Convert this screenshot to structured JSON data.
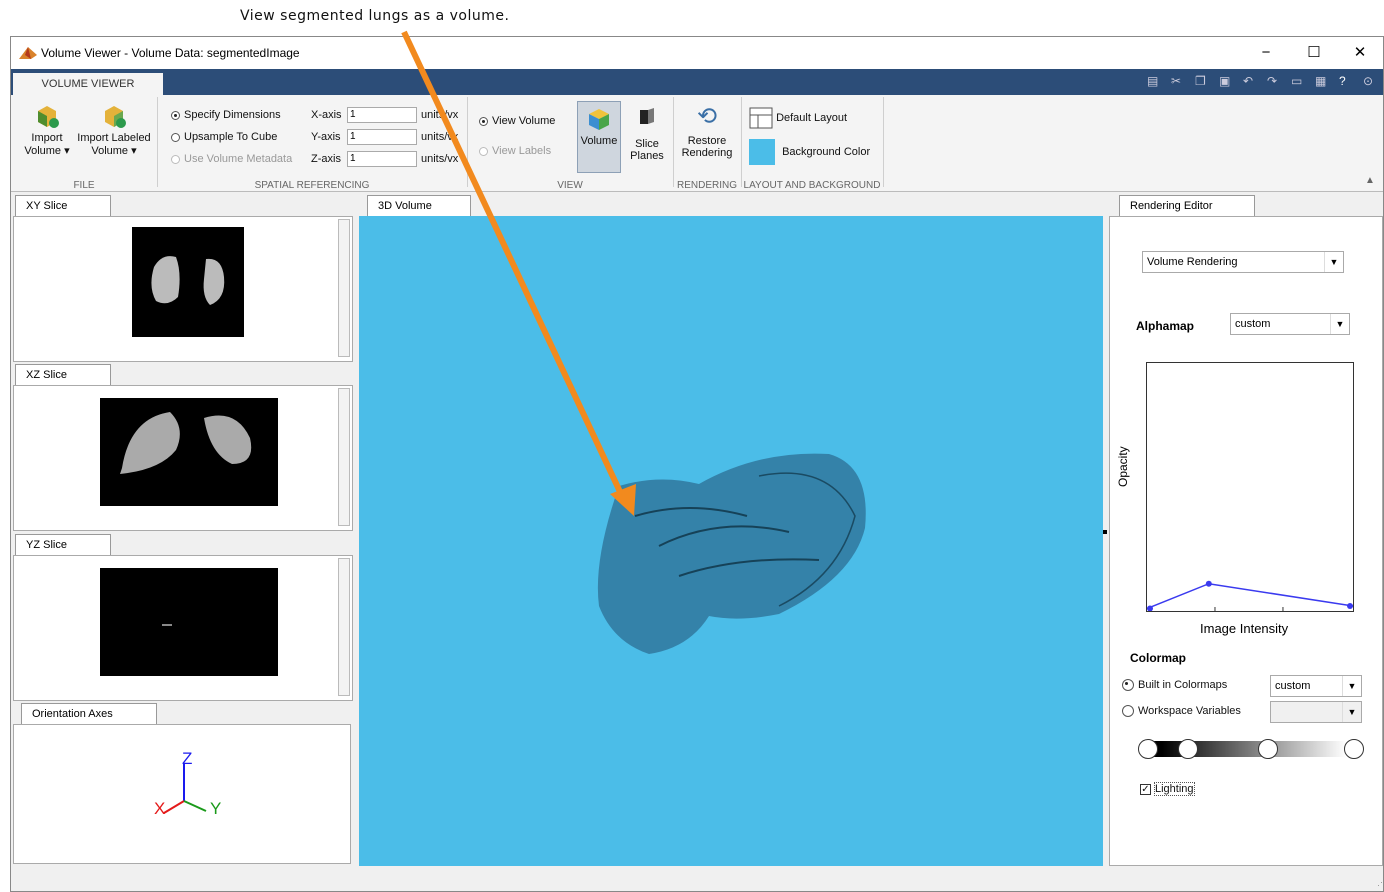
{
  "annotation": "View segmented lungs as a volume.",
  "window": {
    "title": "Volume Viewer - Volume Data: segmentedImage",
    "controls": [
      "−",
      "☐",
      "✕"
    ]
  },
  "ribbon": {
    "tab": "VOLUME VIEWER",
    "file": {
      "import_volume": [
        "Import",
        "Volume ▾"
      ],
      "import_labeled": [
        "Import Labeled",
        "Volume ▾"
      ],
      "group": "FILE"
    },
    "spatial": {
      "specify": "Specify Dimensions",
      "upsample": "Upsample To Cube",
      "metadata": "Use Volume Metadata",
      "x_label": "X-axis",
      "y_label": "Y-axis",
      "z_label": "Z-axis",
      "x_value": "1",
      "y_value": "1",
      "z_value": "1",
      "x_unit": "units/vx",
      "y_unit": "units/vx",
      "z_unit": "units/vx",
      "group": "SPATIAL REFERENCING"
    },
    "view": {
      "view_volume": "View Volume",
      "view_labels": "View Labels",
      "volume": "Volume",
      "slice_planes": [
        "Slice",
        "Planes"
      ],
      "group": "VIEW"
    },
    "rendering": {
      "restore": [
        "Restore",
        "Rendering"
      ],
      "group": "RENDERING"
    },
    "layout": {
      "default_layout": "Default Layout",
      "background_color": "Background Color",
      "group": "LAYOUT AND BACKGROUND"
    }
  },
  "left": {
    "xy_tab": "XY Slice",
    "xz_tab": "XZ Slice",
    "yz_tab": "YZ Slice",
    "orient_tab": "Orientation Axes",
    "axis_x": "X",
    "axis_y": "Y",
    "axis_z": "Z"
  },
  "center": {
    "tab": "3D Volume"
  },
  "editor": {
    "tab": "Rendering Editor",
    "mode": "Volume Rendering",
    "alphamap_label": "Alphamap",
    "alphamap_value": "custom",
    "ylabel": "Opacity",
    "xlabel": "Image Intensity",
    "colormap_label": "Colormap",
    "builtin": "Built in Colormaps",
    "builtin_value": "custom",
    "workspace": "Workspace Variables",
    "lighting": "Lighting",
    "alpha_points": [
      [
        0,
        0.01
      ],
      [
        0.3,
        0.11
      ],
      [
        1,
        0.02
      ]
    ]
  },
  "colors": {
    "volume_bg": "#4bbde8",
    "ribbon_band": "#2c4d78",
    "arrow": "#f28a1e",
    "alpha_line": "#3a3aef"
  }
}
